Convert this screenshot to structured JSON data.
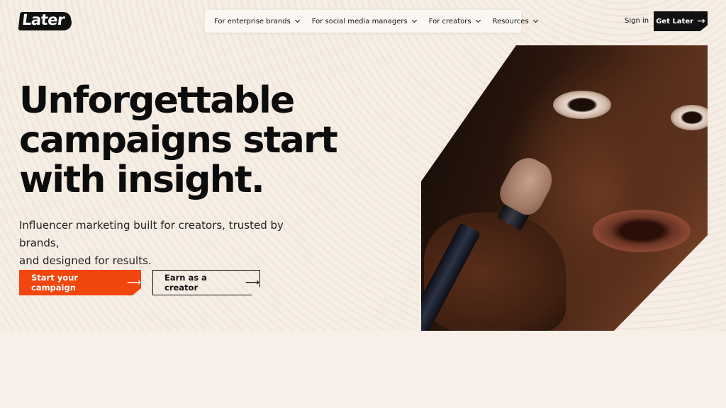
{
  "header": {
    "logo_text": "Later",
    "nav": [
      {
        "label": "For enterprise brands"
      },
      {
        "label": "For social media managers"
      },
      {
        "label": "For creators"
      },
      {
        "label": "Resources"
      }
    ],
    "sign_in_label": "Sign in",
    "cta_label": "Get Later",
    "cta_icon": "arrow-right-icon"
  },
  "hero": {
    "headline_lines": [
      "Unforgettable",
      "campaigns start",
      "with insight."
    ],
    "subtext_lines": [
      "Influencer marketing built for creators, trusted by brands,",
      "and designed for results."
    ],
    "primary_button_label": "Start your campaign",
    "secondary_button_label": "Earn as a creator",
    "button_icon": "arrow-right-icon"
  },
  "colors": {
    "accent": "#f2460f",
    "background": "#f6ede4",
    "text": "#111111"
  }
}
